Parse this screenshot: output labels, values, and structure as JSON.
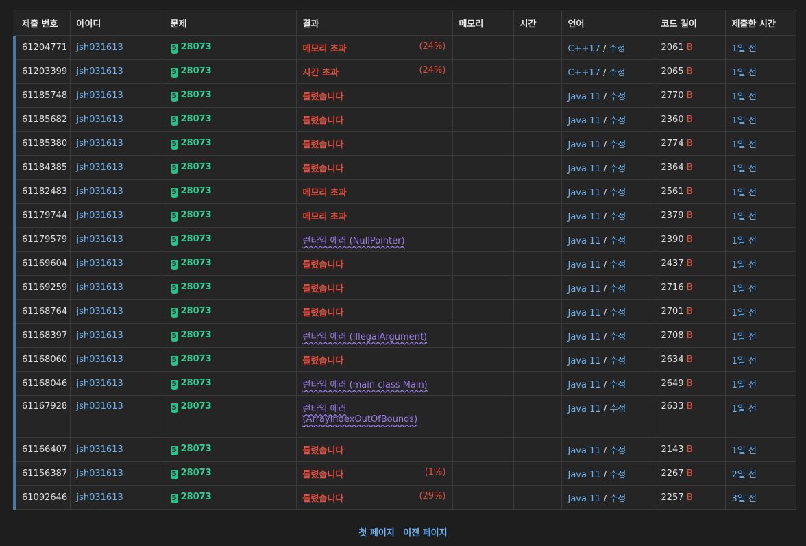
{
  "headers": [
    "제출 번호",
    "아이디",
    "문제",
    "결과",
    "메모리",
    "시간",
    "언어",
    "코드 길이",
    "제출한 시간"
  ],
  "tier_label": "5",
  "byte_unit": "B",
  "edit_label": "수정",
  "rows": [
    {
      "id": "61204771",
      "user": "jsh031613",
      "problem": "28073",
      "result": "메모리 초과",
      "result_type": "red",
      "pct": "(24%)",
      "lang": "C++17",
      "length": "2061",
      "time": "1일 전"
    },
    {
      "id": "61203399",
      "user": "jsh031613",
      "problem": "28073",
      "result": "시간 초과",
      "result_type": "red",
      "pct": "(24%)",
      "lang": "C++17",
      "length": "2065",
      "time": "1일 전"
    },
    {
      "id": "61185748",
      "user": "jsh031613",
      "problem": "28073",
      "result": "틀렸습니다",
      "result_type": "red",
      "pct": "",
      "lang": "Java 11",
      "length": "2770",
      "time": "1일 전"
    },
    {
      "id": "61185682",
      "user": "jsh031613",
      "problem": "28073",
      "result": "틀렸습니다",
      "result_type": "red",
      "pct": "",
      "lang": "Java 11",
      "length": "2360",
      "time": "1일 전"
    },
    {
      "id": "61185380",
      "user": "jsh031613",
      "problem": "28073",
      "result": "틀렸습니다",
      "result_type": "red",
      "pct": "",
      "lang": "Java 11",
      "length": "2774",
      "time": "1일 전"
    },
    {
      "id": "61184385",
      "user": "jsh031613",
      "problem": "28073",
      "result": "틀렸습니다",
      "result_type": "red",
      "pct": "",
      "lang": "Java 11",
      "length": "2364",
      "time": "1일 전"
    },
    {
      "id": "61182483",
      "user": "jsh031613",
      "problem": "28073",
      "result": "메모리 초과",
      "result_type": "red",
      "pct": "",
      "lang": "Java 11",
      "length": "2561",
      "time": "1일 전"
    },
    {
      "id": "61179744",
      "user": "jsh031613",
      "problem": "28073",
      "result": "메모리 초과",
      "result_type": "red",
      "pct": "",
      "lang": "Java 11",
      "length": "2379",
      "time": "1일 전"
    },
    {
      "id": "61179579",
      "user": "jsh031613",
      "problem": "28073",
      "result": "런타임 에러 (NullPointer)",
      "result_type": "purple",
      "pct": "",
      "lang": "Java 11",
      "length": "2390",
      "time": "1일 전"
    },
    {
      "id": "61169604",
      "user": "jsh031613",
      "problem": "28073",
      "result": "틀렸습니다",
      "result_type": "red",
      "pct": "",
      "lang": "Java 11",
      "length": "2437",
      "time": "1일 전"
    },
    {
      "id": "61169259",
      "user": "jsh031613",
      "problem": "28073",
      "result": "틀렸습니다",
      "result_type": "red",
      "pct": "",
      "lang": "Java 11",
      "length": "2716",
      "time": "1일 전"
    },
    {
      "id": "61168764",
      "user": "jsh031613",
      "problem": "28073",
      "result": "틀렸습니다",
      "result_type": "red",
      "pct": "",
      "lang": "Java 11",
      "length": "2701",
      "time": "1일 전"
    },
    {
      "id": "61168397",
      "user": "jsh031613",
      "problem": "28073",
      "result": "런타임 에러 (IllegalArgument)",
      "result_type": "purple",
      "pct": "",
      "lang": "Java 11",
      "length": "2708",
      "time": "1일 전"
    },
    {
      "id": "61168060",
      "user": "jsh031613",
      "problem": "28073",
      "result": "틀렸습니다",
      "result_type": "red",
      "pct": "",
      "lang": "Java 11",
      "length": "2634",
      "time": "1일 전"
    },
    {
      "id": "61168046",
      "user": "jsh031613",
      "problem": "28073",
      "result": "런타임 에러 (main class Main)",
      "result_type": "purple",
      "pct": "",
      "lang": "Java 11",
      "length": "2649",
      "time": "1일 전"
    },
    {
      "id": "61167928",
      "user": "jsh031613",
      "problem": "28073",
      "result": "런타임 에러 (ArrayIndexOutOfBounds)",
      "result_type": "purple",
      "pct": "",
      "lang": "Java 11",
      "length": "2633",
      "time": "1일 전",
      "tall": true
    },
    {
      "id": "61166407",
      "user": "jsh031613",
      "problem": "28073",
      "result": "틀렸습니다",
      "result_type": "red",
      "pct": "",
      "lang": "Java 11",
      "length": "2143",
      "time": "1일 전"
    },
    {
      "id": "61156387",
      "user": "jsh031613",
      "problem": "28073",
      "result": "틀렸습니다",
      "result_type": "red",
      "pct": "(1%)",
      "lang": "Java 11",
      "length": "2267",
      "time": "2일 전"
    },
    {
      "id": "61092646",
      "user": "jsh031613",
      "problem": "28073",
      "result": "틀렸습니다",
      "result_type": "red",
      "pct": "(29%)",
      "lang": "Java 11",
      "length": "2257",
      "time": "3일 전"
    }
  ],
  "pager": {
    "first": "첫 페이지",
    "prev": "이전 페이지"
  }
}
